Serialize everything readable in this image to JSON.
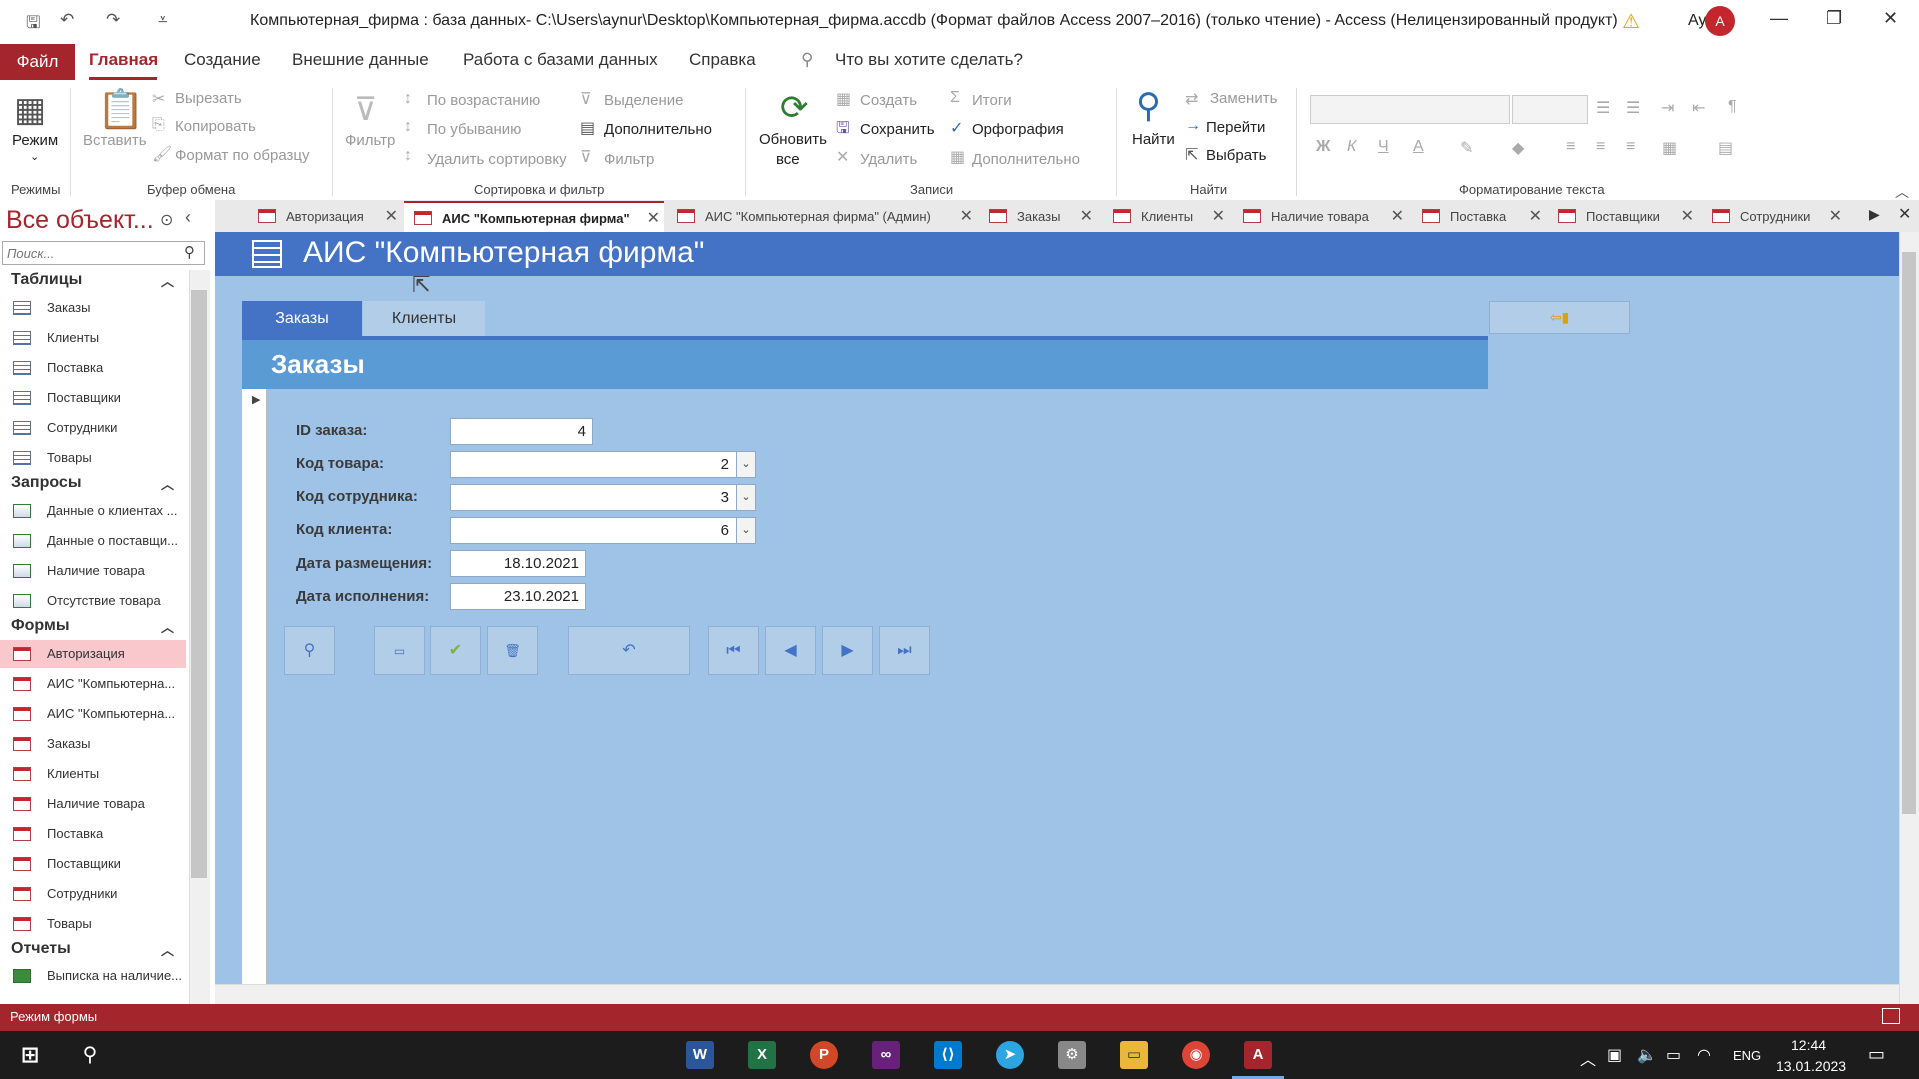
{
  "window": {
    "title": "Компьютерная_фирма : база данных- C:\\Users\\aynur\\Desktop\\Компьютерная_фирма.accdb (Формат файлов Access 2007–2016) (только чтение)  -  Access (Нелицензированный продукт)",
    "user": "Aynur",
    "avatar": "A"
  },
  "menu": {
    "file": "Файл",
    "tabs": [
      "Главная",
      "Создание",
      "Внешние данные",
      "Работа с базами данных",
      "Справка"
    ],
    "tell_me": "Что вы хотите сделать?"
  },
  "ribbon": {
    "views": {
      "label": "Режим",
      "group": "Режимы"
    },
    "clipboard": {
      "paste": "Вставить",
      "cut": "Вырезать",
      "copy": "Копировать",
      "format_painter": "Формат по образцу",
      "group": "Буфер обмена"
    },
    "sort": {
      "filter": "Фильтр",
      "asc": "По возрастанию",
      "desc": "По убыванию",
      "remove": "Удалить сортировку",
      "selection": "Выделение",
      "advanced": "Дополнительно",
      "toggle": "Фильтр",
      "group": "Сортировка и фильтр"
    },
    "records": {
      "refresh": "Обновить",
      "refresh2": "все",
      "new": "Создать",
      "save": "Сохранить",
      "delete": "Удалить",
      "totals": "Итоги",
      "spelling": "Орфография",
      "more": "Дополнительно",
      "group": "Записи"
    },
    "find": {
      "find": "Найти",
      "replace": "Заменить",
      "goto": "Перейти",
      "select": "Выбрать",
      "group": "Найти"
    },
    "text": {
      "bold": "Ж",
      "italic": "К",
      "underline": "Ч",
      "font_color": "А",
      "group": "Форматирование текста"
    }
  },
  "nav": {
    "title": "Все объект...",
    "search_placeholder": "Поиск...",
    "groups": [
      {
        "label": "Таблицы",
        "items": [
          "Заказы",
          "Клиенты",
          "Поставка",
          "Поставщики",
          "Сотрудники",
          "Товары"
        ]
      },
      {
        "label": "Запросы",
        "items": [
          "Данные о клиентах ...",
          "Данные о поставщи...",
          "Наличие товара",
          "Отсутствие товара"
        ]
      },
      {
        "label": "Формы",
        "items": [
          "Авторизация",
          "АИС \"Компьютерна...",
          "АИС \"Компьютерна...",
          "Заказы",
          "Клиенты",
          "Наличие товара",
          "Поставка",
          "Поставщики",
          "Сотрудники",
          "Товары"
        ]
      },
      {
        "label": "Отчеты",
        "items": [
          "Выписка на наличие..."
        ]
      }
    ]
  },
  "doc_tabs": [
    "Авторизация",
    "АИС \"Компьютерная фирма\"",
    "АИС \"Компьютерная фирма\" (Админ)",
    "Заказы",
    "Клиенты",
    "Наличие товара",
    "Поставка",
    "Поставщики",
    "Сотрудники"
  ],
  "form": {
    "header": "АИС \"Компьютерная фирма\"",
    "tabs": [
      "Заказы",
      "Клиенты"
    ],
    "section_title": "Заказы",
    "fields": [
      {
        "label": "ID заказа:",
        "value": "4"
      },
      {
        "label": "Код товара:",
        "value": "2"
      },
      {
        "label": "Код сотрудника:",
        "value": "3"
      },
      {
        "label": "Код клиента:",
        "value": "6"
      },
      {
        "label": "Дата размещения:",
        "value": "18.10.2021"
      },
      {
        "label": "Дата исполнения:",
        "value": "23.10.2021"
      }
    ]
  },
  "status": {
    "text": "Режим формы"
  },
  "taskbar": {
    "lang": "ENG",
    "time": "12:44",
    "date": "13.01.2023"
  },
  "colors": {
    "access": "#a4262c",
    "form_header": "#4472c4",
    "form_bg": "#9fc3e7",
    "subhead": "#5b9bd5"
  }
}
